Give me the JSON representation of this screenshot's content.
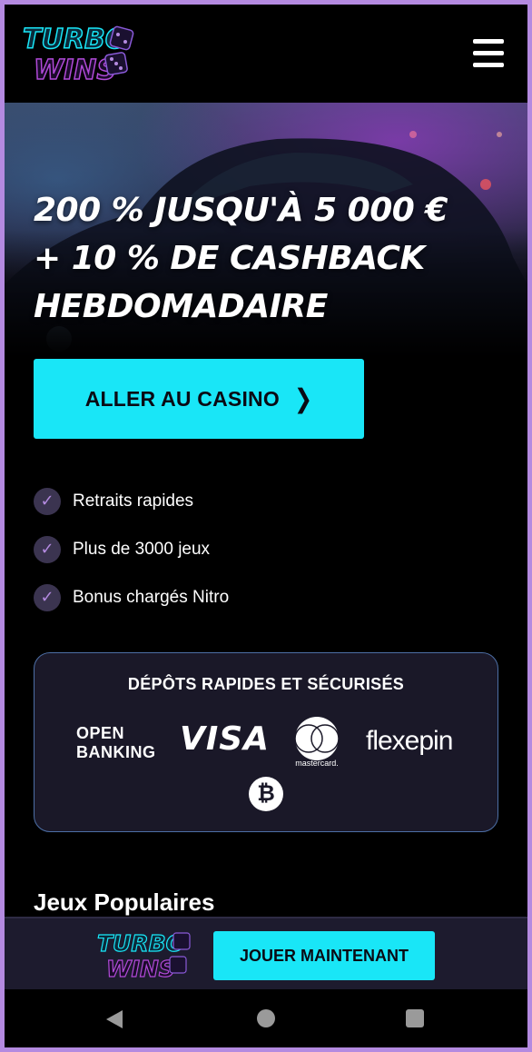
{
  "header": {
    "logo_line1": "TURBO",
    "logo_line2": "WINS",
    "menu_icon": "hamburger-menu-icon"
  },
  "hero": {
    "title_line1": "200 % JUSQU'À 5 000 €",
    "title_line2": "+ 10 % DE CASHBACK",
    "title_line3": "HEBDOMADAIRE",
    "cta_label": "ALLER AU CASINO",
    "cta_icon": "chevron-right-icon"
  },
  "features": [
    {
      "label": "Retraits rapides",
      "icon": "check-icon"
    },
    {
      "label": "Plus de 3000 jeux",
      "icon": "check-icon"
    },
    {
      "label": "Bonus chargés Nitro",
      "icon": "check-icon"
    }
  ],
  "payments": {
    "title": "DÉPÔTS RAPIDES ET SÉCURISÉS",
    "open_banking_line1": "OPEN",
    "open_banking_line2": "BANKING",
    "visa": "VISA",
    "mastercard": "mastercard.",
    "flexepin": "flexepin",
    "bitcoin": "₿"
  },
  "popular_title": "Jeux Populaires",
  "sticky": {
    "logo_line1": "TURBO",
    "logo_line2": "WINS",
    "play_label": "JOUER MAINTENANT"
  },
  "colors": {
    "accent": "#19e6f7",
    "brand_purple": "#b48ae0",
    "card_bg": "#1a1828",
    "card_border": "#4d6fa6"
  }
}
